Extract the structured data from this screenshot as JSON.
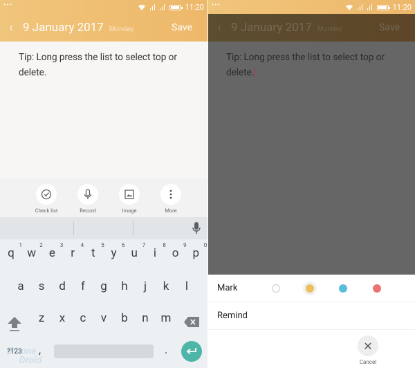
{
  "status": {
    "dots": "•••",
    "time": "11:20"
  },
  "header": {
    "back": "‹",
    "date": "9 January 2017",
    "weekday": "Monday",
    "save": "Save"
  },
  "note": {
    "text": "Tip: Long press the list to select top or delete."
  },
  "toolbar": {
    "items": [
      {
        "label": "Check list",
        "icon": "check-circle-icon"
      },
      {
        "label": "Record",
        "icon": "mic-icon"
      },
      {
        "label": "Image",
        "icon": "image-icon"
      },
      {
        "label": "More",
        "icon": "more-vertical-icon"
      }
    ]
  },
  "keyboard": {
    "row1": [
      {
        "k": "q",
        "n": "1"
      },
      {
        "k": "w",
        "n": "2"
      },
      {
        "k": "e",
        "n": "3"
      },
      {
        "k": "r",
        "n": "4"
      },
      {
        "k": "t",
        "n": "5"
      },
      {
        "k": "y",
        "n": "6"
      },
      {
        "k": "u",
        "n": "7"
      },
      {
        "k": "i",
        "n": "8"
      },
      {
        "k": "o",
        "n": "9"
      },
      {
        "k": "p",
        "n": "0"
      }
    ],
    "row2": [
      "a",
      "s",
      "d",
      "f",
      "g",
      "h",
      "j",
      "k",
      "l"
    ],
    "row3": [
      "z",
      "x",
      "c",
      "v",
      "b",
      "n",
      "m"
    ],
    "symbols": "?123",
    "comma": ",",
    "period": "."
  },
  "watermark": {
    "line1": "iPhone",
    "line2": "Droid"
  },
  "sheet": {
    "mark_label": "Mark",
    "remind_label": "Remind",
    "colors": [
      {
        "name": "none",
        "hex": "#ffffff",
        "selected": false
      },
      {
        "name": "yellow",
        "hex": "#ecc05e",
        "selected": true
      },
      {
        "name": "blue",
        "hex": "#5bbcdc",
        "selected": false
      },
      {
        "name": "red",
        "hex": "#ec7373",
        "selected": false
      }
    ],
    "cancel_label": "Cancel"
  }
}
